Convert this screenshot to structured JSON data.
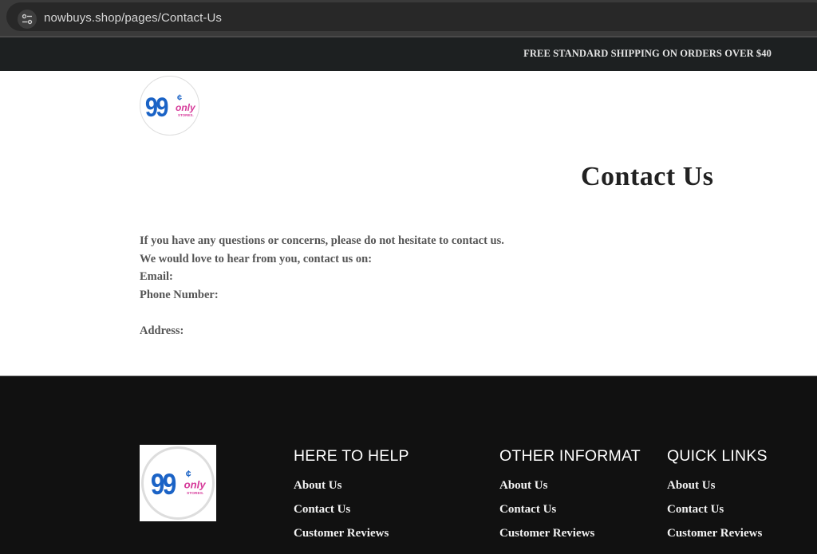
{
  "browser": {
    "url": "nowbuys.shop/pages/Contact-Us",
    "site_info_icon": "tune-icon"
  },
  "announcement": {
    "text": "FREE STANDARD SHIPPING ON ORDERS OVER $40"
  },
  "header": {
    "logo": {
      "main": "99",
      "cent": "¢",
      "only": "only",
      "stores": "STORES.",
      "brand_blue": "#1b63c6",
      "brand_pink": "#d63a9a"
    }
  },
  "main": {
    "title": "Contact Us",
    "lines": [
      "If you have any questions or concerns, please do not hesitate to contact us.",
      "We would love to hear from you, contact us on:",
      "Email:",
      "Phone Number:",
      "",
      "Address:"
    ]
  },
  "footer": {
    "columns": [
      {
        "heading": "HERE TO HELP",
        "links": [
          "About Us",
          "Contact Us",
          "Customer Reviews"
        ]
      },
      {
        "heading": "OTHER INFORMATION",
        "links": [
          "About Us",
          "Contact Us",
          "Customer Reviews"
        ]
      },
      {
        "heading": "QUICK LINKS",
        "links": [
          "About Us",
          "Contact Us",
          "Customer Reviews"
        ]
      }
    ]
  }
}
